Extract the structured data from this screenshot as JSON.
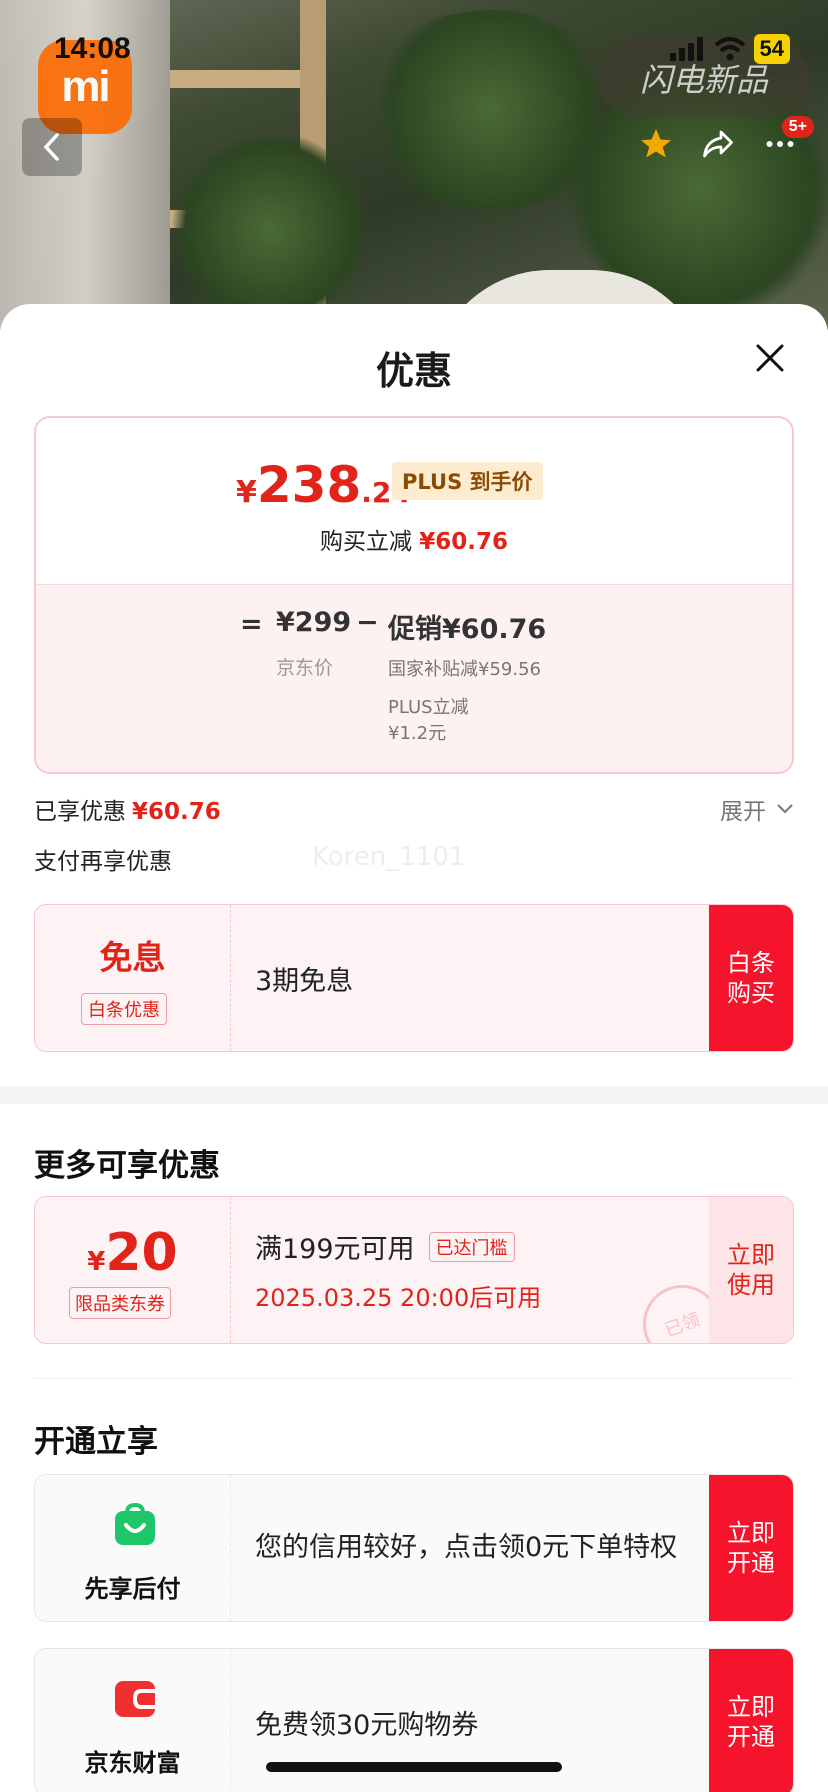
{
  "status_bar": {
    "time": "14:08",
    "battery": "54",
    "notification_badge": "5+"
  },
  "hero": {
    "brand_logo_text": "mi",
    "banner_text": "闪电新品"
  },
  "sheet": {
    "title": "优惠",
    "price_summary": {
      "currency": "¥",
      "price_int": "238",
      "price_dec": ".24",
      "tag": "PLUS 到手价",
      "reduce_label": "购买立减",
      "reduce_value": "¥60.76"
    },
    "calc": {
      "eq": "=",
      "jd_price": "¥299",
      "jd_label": "京东价",
      "minus": "−",
      "promo": "促销¥60.76",
      "sub1": "国家补贴减¥59.56",
      "sub2_line1": "PLUS立减",
      "sub2_line2": "¥1.2元"
    },
    "enjoyed_label": "已享优惠",
    "enjoyed_value": "¥60.76",
    "expand_label": "展开",
    "pay_more_label": "支付再享优惠",
    "watermark": "Koren_1101",
    "interest_offer": {
      "title": "免息",
      "tag": "白条优惠",
      "text": "3期免息",
      "cta": "白条\n购买"
    },
    "more_section_title": "更多可享优惠",
    "coupon": {
      "currency": "¥",
      "amount": "20",
      "tag": "限品类东券",
      "condition": "满199元可用",
      "reached_tag": "已达门槛",
      "available_time": "2025.03.25 20:00后可用",
      "stamp": "已领",
      "cta": "立即\n使用"
    },
    "open_section_title": "开通立享",
    "services": [
      {
        "name": "先享后付",
        "text": "您的信用较好，点击领0元下单特权",
        "cta": "立即\n开通",
        "icon": "shopping-bag-icon",
        "color": "#1ec66a"
      },
      {
        "name": "京东财富",
        "text": "免费领30元购物券",
        "cta": "立即\n开通",
        "icon": "wallet-icon",
        "color": "#f0302f"
      }
    ]
  },
  "colors": {
    "accent_red": "#e2231a",
    "cta_red": "#f5142c",
    "plus_tag_bg": "#fdecd0"
  }
}
